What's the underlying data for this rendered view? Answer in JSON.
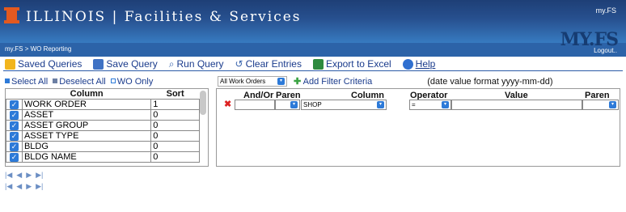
{
  "header": {
    "brand": "ILLINOIS | Facilities & Services",
    "myfs_small": "my.FS",
    "myfs_big": "MY.FS",
    "breadcrumb": "my.FS  >  WO Reporting",
    "logout": "Logout..",
    "colors": {
      "top": "#1e3f76",
      "accent": "#e3591f",
      "bar": "#2c63a8"
    }
  },
  "toolbar": {
    "saved_queries": "Saved Queries",
    "save_query": "Save Query",
    "run_query": "Run Query",
    "clear_entries": "Clear Entries",
    "export_excel": "Export to Excel",
    "help": "Help",
    "icons": [
      "folder-icon",
      "save-icon",
      "search-icon",
      "undo-icon",
      "excel-icon",
      "help-icon"
    ]
  },
  "column_panel": {
    "select_all": "Select All",
    "deselect_all": "Deselect All",
    "wo_only": "WO Only",
    "headers": {
      "column": "Column",
      "sort": "Sort"
    },
    "rows": [
      {
        "name": "WORK ORDER",
        "sort": "1"
      },
      {
        "name": "ASSET",
        "sort": "0"
      },
      {
        "name": "ASSET GROUP",
        "sort": "0"
      },
      {
        "name": "ASSET TYPE",
        "sort": "0"
      },
      {
        "name": "BLDG",
        "sort": "0"
      },
      {
        "name": "BLDG NAME",
        "sort": "0"
      }
    ]
  },
  "filter": {
    "scope": "All Work Orders",
    "add_filter": "Add Filter Criteria",
    "date_format": "(date value format yyyy-mm-dd)",
    "headers": {
      "and_or": "And/Or",
      "paren": "Paren",
      "column": "Column",
      "operator": "Operator",
      "value": "Value",
      "paren2": "Paren"
    },
    "row": {
      "column": "SHOP",
      "operator": "="
    }
  },
  "pager": {
    "symbols": [
      "|◀",
      "◀",
      "▶",
      "▶|"
    ]
  }
}
